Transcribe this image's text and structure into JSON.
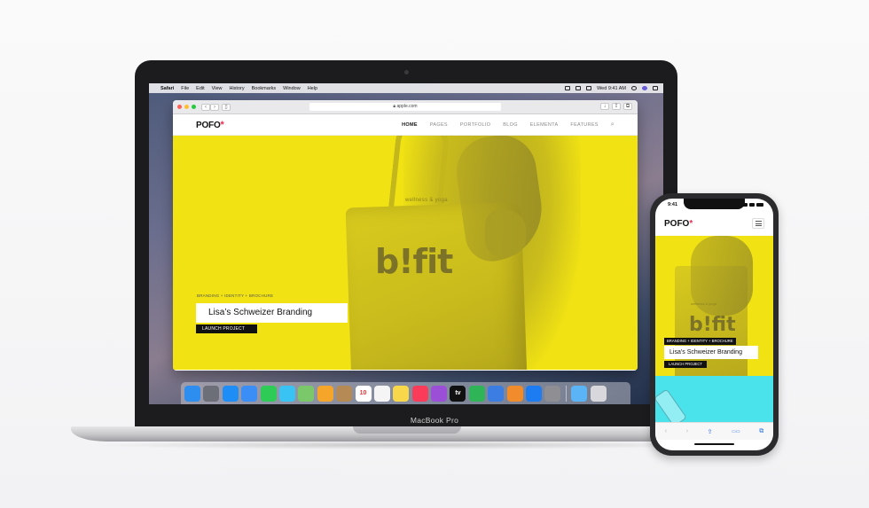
{
  "macbook": {
    "label": "MacBook Pro"
  },
  "menubar": {
    "app": "Safari",
    "items": [
      "File",
      "Edit",
      "View",
      "History",
      "Bookmarks",
      "Window",
      "Help"
    ],
    "clock": "Wed 9:41 AM"
  },
  "safari": {
    "url": "apple.com"
  },
  "site": {
    "logo": "POFO",
    "logo_star": "*",
    "nav": [
      "HOME",
      "PAGES",
      "PORTFOLIO",
      "BLOG",
      "ELEMENTA",
      "FEATURES"
    ],
    "hero": {
      "bag_text_small": "wellness & yoga",
      "bag_brand": "b!fit",
      "tagline": "BRANDING + IDENTITY + BROCHURE",
      "title": "Lisa’s Schweizer Branding",
      "button": "LAUNCH PROJECT"
    }
  },
  "dock": {
    "icons": [
      {
        "name": "finder-icon",
        "color": "#2e8ef0",
        "glyph": ""
      },
      {
        "name": "launchpad-icon",
        "color": "#6c6f78",
        "glyph": ""
      },
      {
        "name": "safari-icon",
        "color": "#1e8df5",
        "glyph": ""
      },
      {
        "name": "mail-icon",
        "color": "#3a8ef6",
        "glyph": ""
      },
      {
        "name": "facetime-icon",
        "color": "#2ecc56",
        "glyph": ""
      },
      {
        "name": "messages-icon",
        "color": "#39c3f5",
        "glyph": ""
      },
      {
        "name": "maps-icon",
        "color": "#7bc86a",
        "glyph": ""
      },
      {
        "name": "photos-icon",
        "color": "#f4a52a",
        "glyph": ""
      },
      {
        "name": "contacts-icon",
        "color": "#b58a54",
        "glyph": ""
      },
      {
        "name": "calendar-icon",
        "color": "#ffffff",
        "glyph": "10"
      },
      {
        "name": "reminders-icon",
        "color": "#f5f5f5",
        "glyph": ""
      },
      {
        "name": "notes-icon",
        "color": "#f8d84a",
        "glyph": ""
      },
      {
        "name": "music-icon",
        "color": "#fa3c5a",
        "glyph": ""
      },
      {
        "name": "podcasts-icon",
        "color": "#9b4fd6",
        "glyph": ""
      },
      {
        "name": "tv-icon",
        "color": "#111111",
        "glyph": "tv"
      },
      {
        "name": "numbers-icon",
        "color": "#2fb457",
        "glyph": ""
      },
      {
        "name": "keynote-icon",
        "color": "#3b7de0",
        "glyph": ""
      },
      {
        "name": "pages-icon",
        "color": "#f08c2b",
        "glyph": ""
      },
      {
        "name": "app-store-icon",
        "color": "#1d7cf2",
        "glyph": ""
      },
      {
        "name": "system-preferences-icon",
        "color": "#8e8e93",
        "glyph": ""
      }
    ],
    "right_icons": [
      {
        "name": "downloads-folder-icon",
        "color": "#5ab4f5",
        "glyph": ""
      },
      {
        "name": "trash-icon",
        "color": "#d8d8dc",
        "glyph": ""
      }
    ]
  },
  "iphone": {
    "time": "9:41",
    "logo": "POFO",
    "logo_star": "*",
    "bag_text_small": "wellness & yoga",
    "bag_brand": "b!fit",
    "tagline": "BRANDING + IDENTITY + BROCHURE",
    "title": "Lisa’s Schweizer Branding",
    "button": "LAUNCH PROJECT",
    "toolbar": [
      "‹",
      "›",
      "⇪",
      "▭▭",
      "⧉"
    ]
  }
}
